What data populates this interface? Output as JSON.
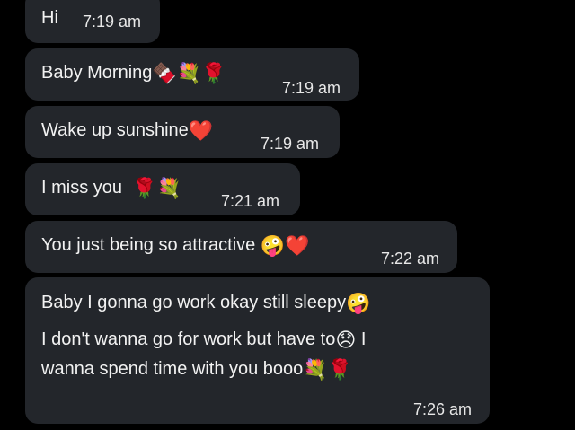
{
  "messages": [
    {
      "text": "Hi",
      "emojis": "",
      "time": "7:19 am"
    },
    {
      "text": "Baby Morning",
      "emojis": "🍫💐🌹",
      "time": "7:19 am"
    },
    {
      "text": "Wake up sunshine",
      "emojis": "❤️",
      "time": "7:19 am"
    },
    {
      "text": "I miss you",
      "emojis": "🌹💐",
      "time": "7:21 am"
    },
    {
      "text": "You just being so attractive",
      "emojis": "🤪❤️",
      "time": "7:22 am"
    },
    {
      "line1": "Baby I gonna go work okay still sleepy",
      "line1_emoji": "🤪",
      "line2": "I don't wanna go for work but have to",
      "line2_emoji": "😞",
      "line2_tail": " I",
      "line3": "wanna spend time with you booo",
      "line3_emojis": "💐🌹",
      "time": "7:26 am"
    }
  ]
}
